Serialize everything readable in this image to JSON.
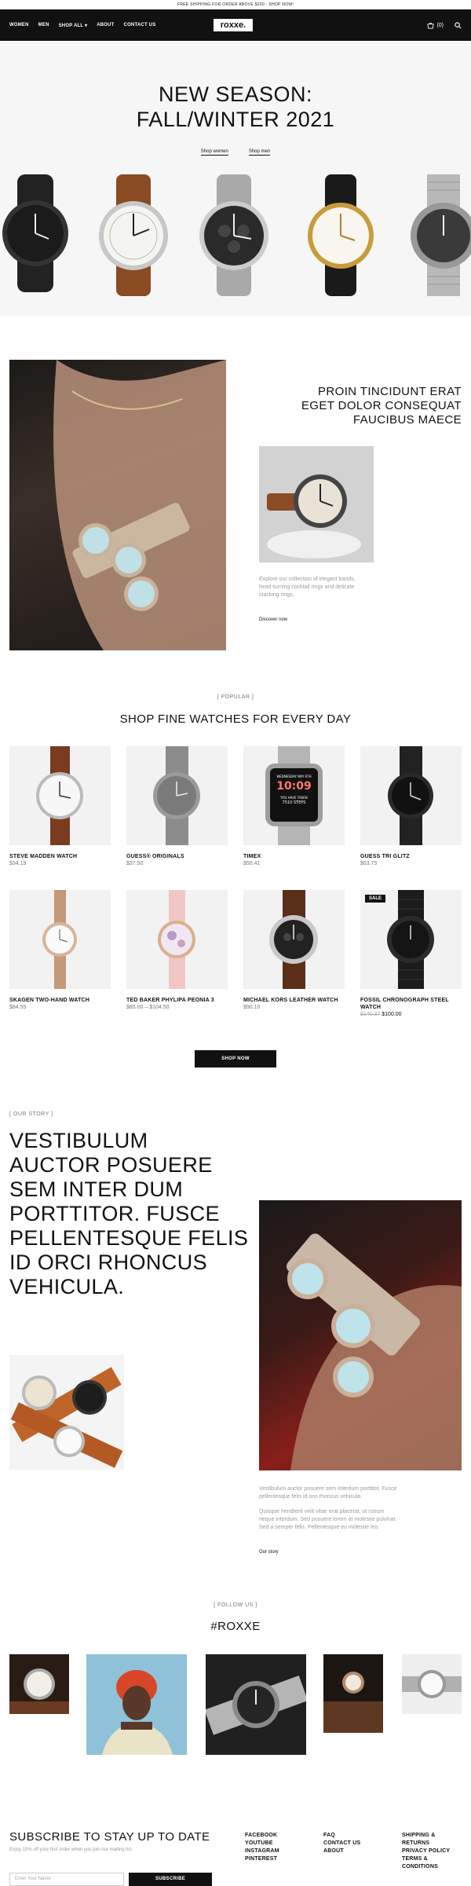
{
  "topbar": {
    "text": "FREE SHIPPING FOR ORDER ABOVE $200 · SHOP NOW!"
  },
  "nav": {
    "links": [
      "WOMEN",
      "MEN",
      "SHOP ALL ▾",
      "ABOUT",
      "CONTACT US"
    ],
    "logo": "roxxe.",
    "cart_count": "(0)"
  },
  "hero": {
    "title_line1": "NEW SEASON:",
    "title_line2": "FALL/WINTER 2021",
    "link_women": "Shop women",
    "link_men": "Shop men"
  },
  "feature": {
    "heading_line1": "PROIN TINCIDUNT ERAT",
    "heading_line2": "EGET DOLOR CONSEQUAT",
    "heading_line3": "FAUCIBUS MAECE",
    "desc_line1": "Explore our collection of elegant bands,",
    "desc_line2": "head-turning cocktail rings and delicate",
    "desc_line3": "stacking rings.",
    "link": "Discover now"
  },
  "popular": {
    "tag": "[ POPULAR ]",
    "heading": "SHOP FINE WATCHES FOR EVERY DAY",
    "products": [
      {
        "name": "STEVE MADDEN WATCH",
        "price": "$34.19"
      },
      {
        "name": "GUESS® ORIGINALS",
        "price": "$37.50"
      },
      {
        "name": "TIMEX",
        "price": "$50.41"
      },
      {
        "name": "GUESS TRI GLITZ",
        "price": "$63.75"
      },
      {
        "name": "SKAGEN TWO-HAND WATCH",
        "price": "$84.55"
      },
      {
        "name": "TED BAKER PHYLIPA PEONIA 3",
        "price": "$85.00 – $104.50"
      },
      {
        "name": "MICHAEL KORS LEATHER WATCH",
        "price": "$90.10"
      },
      {
        "name": "FOSSIL CHRONOGRAPH STEEL",
        "name2": "WATCH",
        "price_old": "$140.37",
        "price": "$100.00",
        "badge": "SALE"
      }
    ],
    "smartwatch_text1": "WEDNESDAY MAY 6TH",
    "smartwatch_time": "10:09",
    "smartwatch_text2": "YOU HAVE TAKEN",
    "smartwatch_text3": "7510 STEPS",
    "button": "SHOP NOW"
  },
  "story": {
    "tag": "[ OUR STORY ]",
    "lines": [
      "VESTIBULUM",
      "AUCTOR POSUERE",
      "SEM INTER DUM",
      "PORTTITOR. FUSCE",
      "PELLENTESQUE FELIS",
      "ID ORCI RHONCUS",
      "VEHICULA."
    ],
    "para1_line1": "Vestibulum auctor posuere sem interdum porttitor. Fusce",
    "para1_line2": "pellentesque felis id orci rhoncus vehicula.",
    "para2_line1": "Quisque hendrerit velit vitae erat placerat, ut rutrum",
    "para2_line2": "neque interdum. Sed posuere lorem at molestie pulvinar.",
    "para2_line3": "Sed a semper felis. Pellentesque eu molestie leo.",
    "link": "Our story"
  },
  "follow": {
    "tag": "[ FOLLOW US ]",
    "heading": "#ROXXE"
  },
  "footer": {
    "subscribe_heading": "SUBSCRIBE TO STAY UP TO DATE",
    "subscribe_sub": "Enjoy 15% off your first order when you join our mailing list.",
    "name_placeholder": "Enter Your Name",
    "subscribe_button": "SUBSCRIBE",
    "col1": [
      "FACEBOOK",
      "YOUTUBE",
      "INSTAGRAM",
      "PINTEREST"
    ],
    "col2": [
      "FAQ",
      "CONTACT US",
      "ABOUT"
    ],
    "col3_1": "SHIPPING &",
    "col3_1b": "RETURNS",
    "col3_2": "PRIVACY POLICY",
    "col3_3": "TERMS &",
    "col3_3b": "CONDITIONS"
  },
  "colors": {
    "dark": "#111111",
    "hero_bg": "#f6f6f6",
    "card_bg": "#f2f2f2",
    "muted": "#9a9a9a"
  }
}
